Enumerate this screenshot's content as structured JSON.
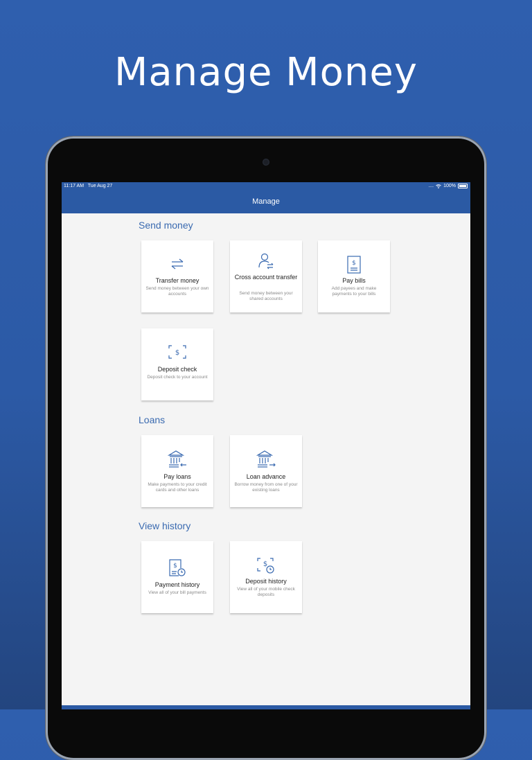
{
  "promo": {
    "title": "Manage Money"
  },
  "status_bar": {
    "time": "11:17 AM",
    "date": "Tue Aug 27",
    "signal": "....",
    "battery": "100%"
  },
  "nav": {
    "title": "Manage"
  },
  "sections": {
    "send_money": {
      "title": "Send money",
      "cards": [
        {
          "title": "Transfer money",
          "desc": "Send money between your own accounts",
          "icon": "transfer-arrows-icon"
        },
        {
          "title": "Cross account transfer",
          "desc": "Send money between your shared accounts",
          "icon": "person-transfer-icon"
        },
        {
          "title": "Pay bills",
          "desc": "Add payees and make payments to your bills",
          "icon": "bill-dollar-icon"
        },
        {
          "title": "Deposit check",
          "desc": "Deposit check to your account",
          "icon": "check-scan-icon"
        }
      ]
    },
    "loans": {
      "title": "Loans",
      "cards": [
        {
          "title": "Pay loans",
          "desc": "Make payments to your credit cards and other loans",
          "icon": "bank-arrow-left-icon"
        },
        {
          "title": "Loan advance",
          "desc": "Borrow money from one of your existing loans",
          "icon": "bank-arrow-right-icon"
        }
      ]
    },
    "history": {
      "title": "View history",
      "cards": [
        {
          "title": "Payment history",
          "desc": "View all of your bill payments",
          "icon": "bill-clock-icon"
        },
        {
          "title": "Deposit history",
          "desc": "View all of your mobile check deposits",
          "icon": "scan-clock-icon"
        }
      ]
    }
  },
  "colors": {
    "accent": "#2b5aa4",
    "section_title": "#3a6ab0",
    "icon": "#3a6ab0"
  }
}
